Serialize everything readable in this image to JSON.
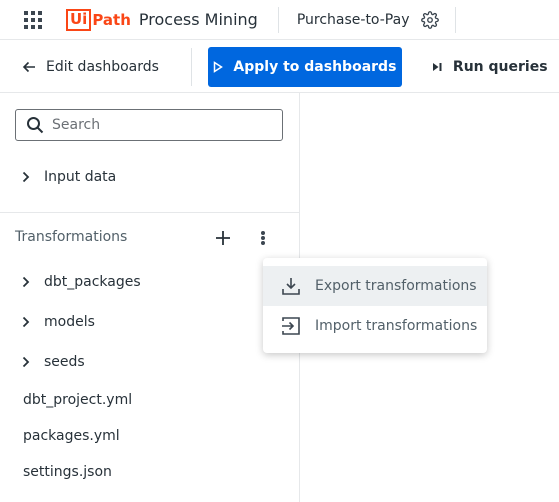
{
  "header": {
    "logo_ui": "Ui",
    "logo_path": "Path",
    "product_name": "Process Mining",
    "app_name": "Purchase-to-Pay",
    "icons": [
      "apps-grid-icon",
      "gear-icon"
    ]
  },
  "toolbar": {
    "edit_label": "Edit dashboards",
    "apply_label": "Apply to dashboards",
    "run_label": "Run queries",
    "colors": {
      "primary": "#0067df"
    }
  },
  "left_panel": {
    "search": {
      "placeholder": "Search",
      "value": ""
    },
    "input_data_label": "Input data",
    "transformations_title": "Transformations",
    "folders": [
      {
        "label": "dbt_packages"
      },
      {
        "label": "models"
      },
      {
        "label": "seeds"
      }
    ],
    "files": [
      {
        "label": "dbt_project.yml"
      },
      {
        "label": "packages.yml"
      },
      {
        "label": "settings.json"
      }
    ]
  },
  "menu": {
    "items": [
      {
        "label": "Export transformations",
        "icon": "download-icon",
        "hovered": true
      },
      {
        "label": "Import transformations",
        "icon": "import-icon",
        "hovered": false
      }
    ]
  },
  "brand_color": "#fa4616"
}
